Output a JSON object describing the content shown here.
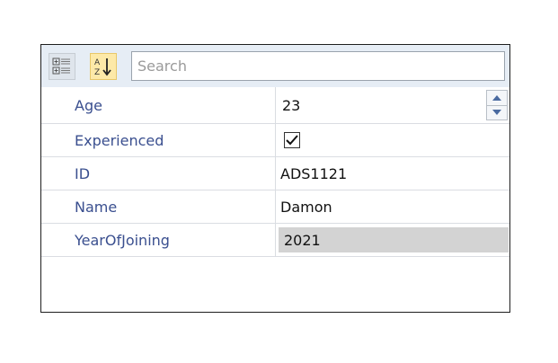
{
  "toolbar": {
    "categorized_icon": "categorized-view-icon",
    "sort_icon": "sort-alphabetical-icon",
    "search_placeholder": "Search",
    "search_value": "",
    "accent_color": "#fde9a8"
  },
  "properties": [
    {
      "name": "Age",
      "value": "23",
      "editor": "numeric"
    },
    {
      "name": "Experienced",
      "value": true,
      "editor": "checkbox"
    },
    {
      "name": "ID",
      "value": "ADS1121",
      "editor": "text"
    },
    {
      "name": "Name",
      "value": "Damon",
      "editor": "text"
    },
    {
      "name": "YearOfJoining",
      "value": "2021",
      "editor": "readonly"
    }
  ],
  "colors": {
    "property_name": "#3a4f8f",
    "readonly_background": "#d3d3d3",
    "toolbar_background": "#e6edf5"
  }
}
